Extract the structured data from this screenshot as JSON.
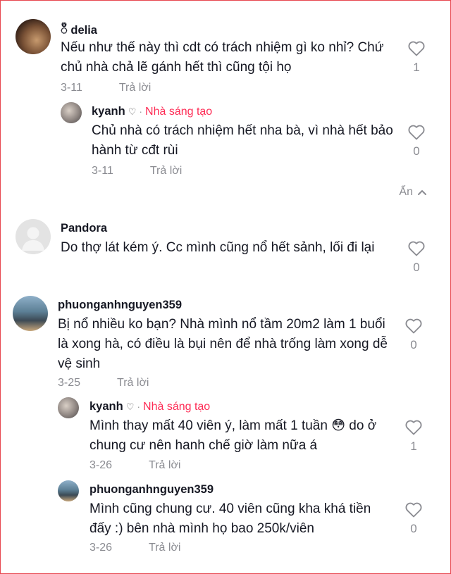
{
  "comments": [
    {
      "username": "ᬁ delia",
      "text": "Nếu như thế này thì cdt có trách nhiệm gì ko nhỉ? Chứ chủ nhà chả lẽ gánh hết thì cũng tội họ",
      "date": "3-11",
      "reply_label": "Trả lời",
      "likes": "1",
      "replies": [
        {
          "username": "kyanh",
          "creator_label": "Nhà sáng tạo",
          "text": "Chủ nhà có trách nhiệm hết nha bà, vì nhà hết bảo hành từ cđt rùi",
          "date": "3-11",
          "reply_label": "Trả lời",
          "likes": "0"
        }
      ],
      "hide_label": "Ẩn"
    },
    {
      "username": "Pandora",
      "text": "Do thợ lát kém ý. Cc mình cũng nổ hết sảnh, lối đi lại",
      "likes": "0"
    },
    {
      "username": "phuonganhnguyen359",
      "text": "Bị nổ nhiều ko bạn? Nhà mình nổ tầm 20m2 làm 1 buổi là xong hà, có điều là bụi nên để nhà trống làm xong dễ vệ sinh",
      "date": "3-25",
      "reply_label": "Trả lời",
      "likes": "0",
      "replies": [
        {
          "username": "kyanh",
          "creator_label": "Nhà sáng tạo",
          "text": "Mình thay mất 40 viên ý, làm mất 1 tuần 😳 do ở chung cư nên hanh chế giờ làm nữa á",
          "date": "3-26",
          "reply_label": "Trả lời",
          "likes": "1"
        },
        {
          "username": "phuonganhnguyen359",
          "text": "Mình cũng chung cư. 40 viên cũng kha khá tiền đấy :) bên nhà mình họ bao 250k/viên",
          "date": "3-26",
          "reply_label": "Trả lời",
          "likes": "0"
        }
      ]
    }
  ],
  "icons": {
    "like": "heart-outline-icon",
    "hide": "chevron-up-icon",
    "creator_heart": "small-heart-icon"
  },
  "colors": {
    "accent": "#fe2c55",
    "muted": "#8a8b91",
    "text": "#161823"
  }
}
